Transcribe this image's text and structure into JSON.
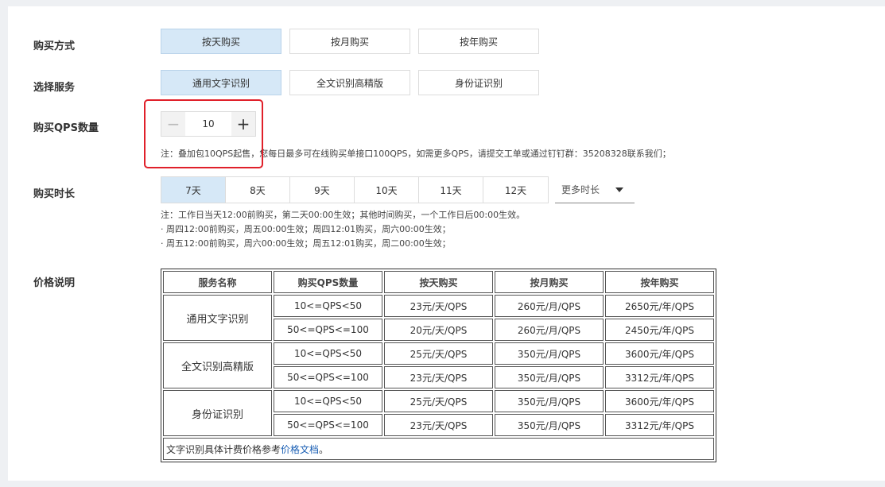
{
  "labels": {
    "purchase_method": "购买方式",
    "select_service": "选择服务",
    "qps_count": "购买QPS数量",
    "duration": "购买时长",
    "price_note": "价格说明"
  },
  "purchase_methods": [
    {
      "label": "按天购买",
      "selected": true
    },
    {
      "label": "按月购买",
      "selected": false
    },
    {
      "label": "按年购买",
      "selected": false
    }
  ],
  "services": [
    {
      "label": "通用文字识别",
      "selected": true
    },
    {
      "label": "全文识别高精版",
      "selected": false
    },
    {
      "label": "身份证识别",
      "selected": false
    }
  ],
  "qps": {
    "minus": "−",
    "value": "10",
    "plus": "+",
    "note": "注：叠加包10QPS起售，您每日最多可在线购买单接口100QPS，如需更多QPS，请提交工单或通过钉钉群：35208328联系我们；"
  },
  "durations": [
    {
      "label": "7天",
      "selected": true
    },
    {
      "label": "8天",
      "selected": false
    },
    {
      "label": "9天",
      "selected": false
    },
    {
      "label": "10天",
      "selected": false
    },
    {
      "label": "11天",
      "selected": false
    },
    {
      "label": "12天",
      "selected": false
    }
  ],
  "more_duration": "更多时长",
  "duration_notes": [
    "注：工作日当天12:00前购买，第二天00:00生效；其他时间购买，一个工作日后00:00生效。",
    "· 周四12:00前购买，周五00:00生效；周四12:01购买，周六00:00生效；",
    "· 周五12:00前购买，周六00:00生效；周五12:01购买，周二00:00生效；"
  ],
  "price_table": {
    "headers": [
      "服务名称",
      "购买QPS数量",
      "按天购买",
      "按月购买",
      "按年购买"
    ],
    "groups": [
      {
        "service": "通用文字识别",
        "rows": [
          [
            "10<=QPS<50",
            "23元/天/QPS",
            "260元/月/QPS",
            "2650元/年/QPS"
          ],
          [
            "50<=QPS<=100",
            "20元/天/QPS",
            "260元/月/QPS",
            "2450元/年/QPS"
          ]
        ]
      },
      {
        "service": "全文识别高精版",
        "rows": [
          [
            "10<=QPS<50",
            "25元/天/QPS",
            "350元/月/QPS",
            "3600元/年/QPS"
          ],
          [
            "50<=QPS<=100",
            "23元/天/QPS",
            "350元/月/QPS",
            "3312元/年/QPS"
          ]
        ]
      },
      {
        "service": "身份证识别",
        "rows": [
          [
            "10<=QPS<50",
            "25元/天/QPS",
            "350元/月/QPS",
            "3600元/年/QPS"
          ],
          [
            "50<=QPS<=100",
            "23元/天/QPS",
            "350元/月/QPS",
            "3312元/年/QPS"
          ]
        ]
      }
    ],
    "footer_prefix": "文字识别具体计费价格参考",
    "footer_link": "价格文档",
    "footer_suffix": "。"
  },
  "colors": {
    "selected_bg": "#d6e8f7",
    "highlight_border": "#e0202a",
    "link": "#1a5fb4"
  }
}
